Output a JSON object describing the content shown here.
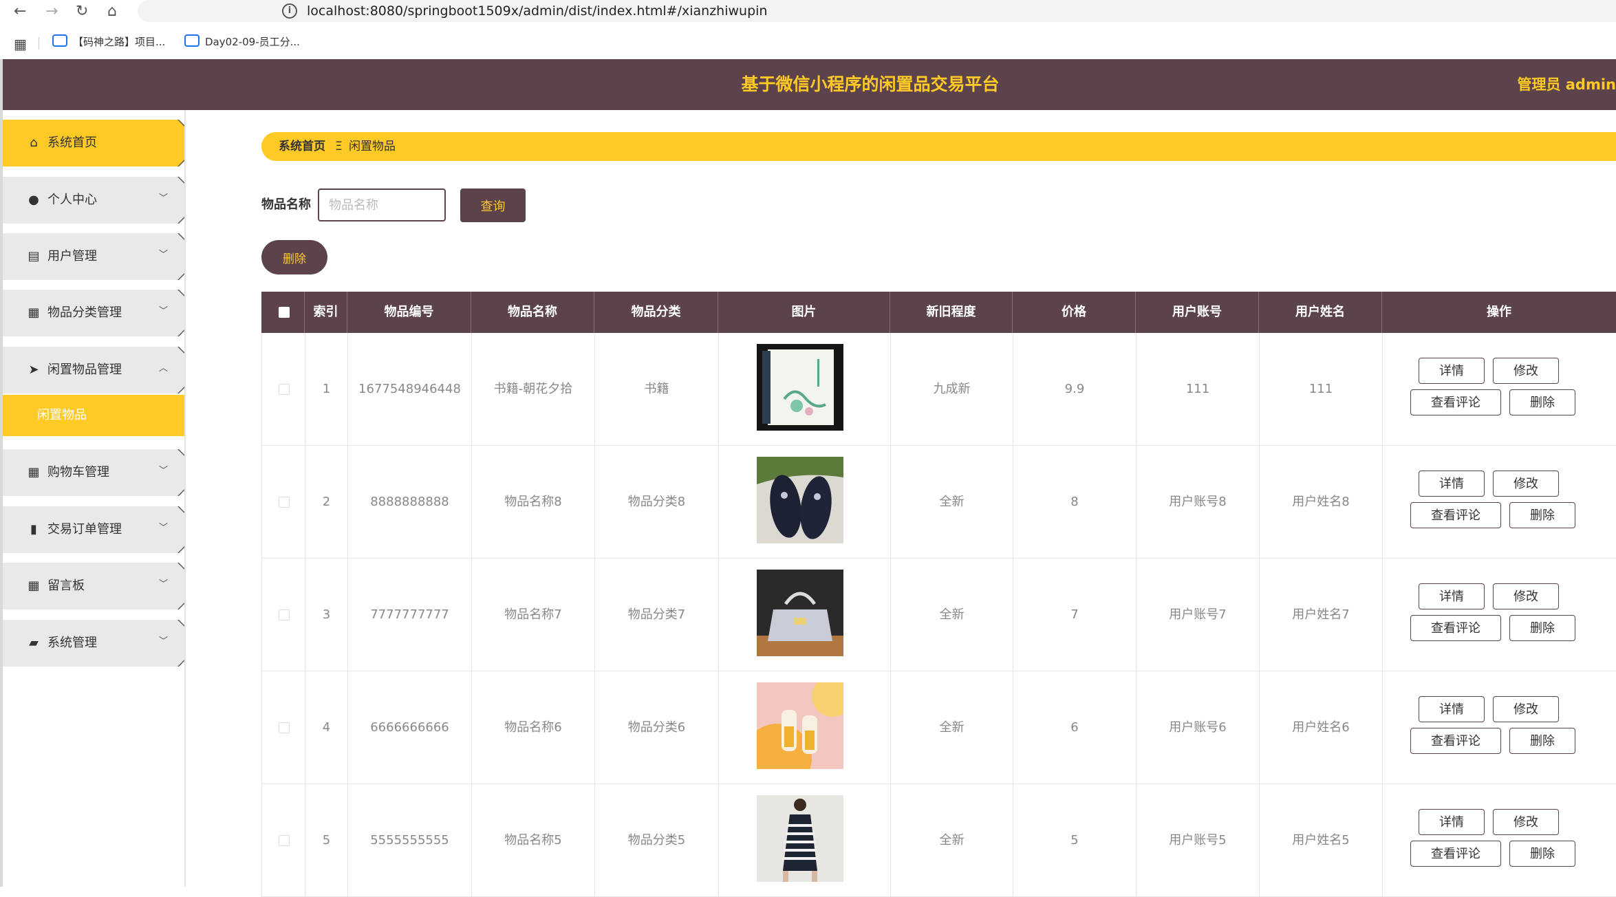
{
  "browser": {
    "url": "localhost:8080/springboot1509x/admin/dist/index.html#/xianzhiwupin",
    "bookmarks": [
      "【码神之路】项目...",
      "Day02-09-员工分..."
    ]
  },
  "header": {
    "title": "基于微信小程序的闲置品交易平台",
    "user": "管理员 admin"
  },
  "sidebar": {
    "items": [
      {
        "label": "系统首页",
        "icon": "home-icon"
      },
      {
        "label": "个人中心",
        "icon": "person-icon"
      },
      {
        "label": "用户管理",
        "icon": "chat-icon"
      },
      {
        "label": "物品分类管理",
        "icon": "grid-icon"
      },
      {
        "label": "闲置物品管理",
        "icon": "send-icon"
      },
      {
        "label": "购物车管理",
        "icon": "grid-icon"
      },
      {
        "label": "交易订单管理",
        "icon": "bar-chart-icon"
      },
      {
        "label": "留言板",
        "icon": "grid-icon"
      },
      {
        "label": "系统管理",
        "icon": "briefcase-icon"
      }
    ],
    "submenu": {
      "label": "闲置物品"
    }
  },
  "breadcrumb": {
    "home": "系统首页",
    "separator": "Ξ",
    "current": "闲置物品"
  },
  "search": {
    "label": "物品名称",
    "placeholder": "物品名称",
    "button": "查询"
  },
  "actions": {
    "batch_delete": "删除"
  },
  "table": {
    "columns": [
      "索引",
      "物品编号",
      "物品名称",
      "物品分类",
      "图片",
      "新旧程度",
      "价格",
      "用户账号",
      "用户姓名",
      "操作"
    ],
    "op_labels": {
      "detail": "详情",
      "edit": "修改",
      "comments": "查看评论",
      "delete": "删除"
    },
    "rows": [
      {
        "index": "1",
        "code": "1677548946448",
        "name": "书籍-朝花夕拾",
        "category": "书籍",
        "condition": "九成新",
        "price": "9.9",
        "account": "111",
        "username": "111",
        "image": "book"
      },
      {
        "index": "2",
        "code": "8888888888",
        "name": "物品名称8",
        "category": "物品分类8",
        "condition": "全新",
        "price": "8",
        "account": "用户账号8",
        "username": "用户姓名8",
        "image": "shoes"
      },
      {
        "index": "3",
        "code": "7777777777",
        "name": "物品名称7",
        "category": "物品分类7",
        "condition": "全新",
        "price": "7",
        "account": "用户账号7",
        "username": "用户姓名7",
        "image": "bag"
      },
      {
        "index": "4",
        "code": "6666666666",
        "name": "物品名称6",
        "category": "物品分类6",
        "condition": "全新",
        "price": "6",
        "account": "用户账号6",
        "username": "用户姓名6",
        "image": "bottles"
      },
      {
        "index": "5",
        "code": "5555555555",
        "name": "物品名称5",
        "category": "物品分类5",
        "condition": "全新",
        "price": "5",
        "account": "用户账号5",
        "username": "用户姓名5",
        "image": "dress"
      }
    ]
  },
  "colors": {
    "brand": "#5c434b",
    "accent": "#ffc926"
  }
}
